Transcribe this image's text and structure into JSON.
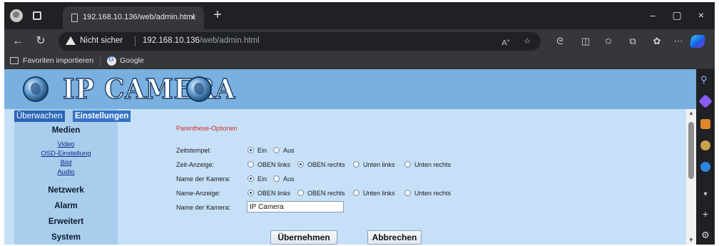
{
  "browser": {
    "tab_title": "192.168.10.136/web/admin.html",
    "tab_close": "×",
    "new_tab": "+",
    "window_controls": {
      "minimize": "–",
      "maximize": "▢",
      "close": "×"
    },
    "security_label": "Nicht sicher",
    "url_host": "192.168.10.136",
    "url_path": "/web/admin.html",
    "bookmarks": [
      {
        "label": "Favoriten importieren",
        "icon": "folder-icon"
      },
      {
        "label": "Google",
        "icon": "google-icon"
      }
    ]
  },
  "banner": {
    "title": "IP CAMERA"
  },
  "nav": {
    "tabs": [
      {
        "label": "Überwachen",
        "active": false
      },
      {
        "label": "Einstellungen",
        "active": true
      }
    ],
    "sections": [
      {
        "label": "Medien",
        "items": [
          "Video",
          "OSD-Einstellung",
          "Bild",
          "Audio"
        ]
      },
      {
        "label": "Netzwerk",
        "items": []
      },
      {
        "label": "Alarm",
        "items": []
      },
      {
        "label": "Erweitert",
        "items": []
      },
      {
        "label": "System",
        "items": []
      }
    ]
  },
  "form": {
    "section_title": "Parenthese-Optionen",
    "rows": [
      {
        "label": "Zeitstempel:",
        "options": [
          "Ein",
          "Aus"
        ],
        "selected": 0
      },
      {
        "label": "Zeit-Anzeige:",
        "options": [
          "OBEN links",
          "OBEN rechts",
          "Unten links",
          "Unten rechts"
        ],
        "selected": 1
      },
      {
        "label": "Name der Kamera:",
        "options": [
          "Ein",
          "Aus"
        ],
        "selected": 0
      },
      {
        "label": "Name-Anzeige:",
        "options": [
          "OBEN links",
          "OBEN rechts",
          "Unten links",
          "Unten rechts"
        ],
        "selected": 0
      }
    ],
    "camera_name_label": "Name der Kamera:",
    "camera_name_value": "IP Camera",
    "apply_button": "Übernehmen",
    "cancel_button": "Abbrechen"
  }
}
